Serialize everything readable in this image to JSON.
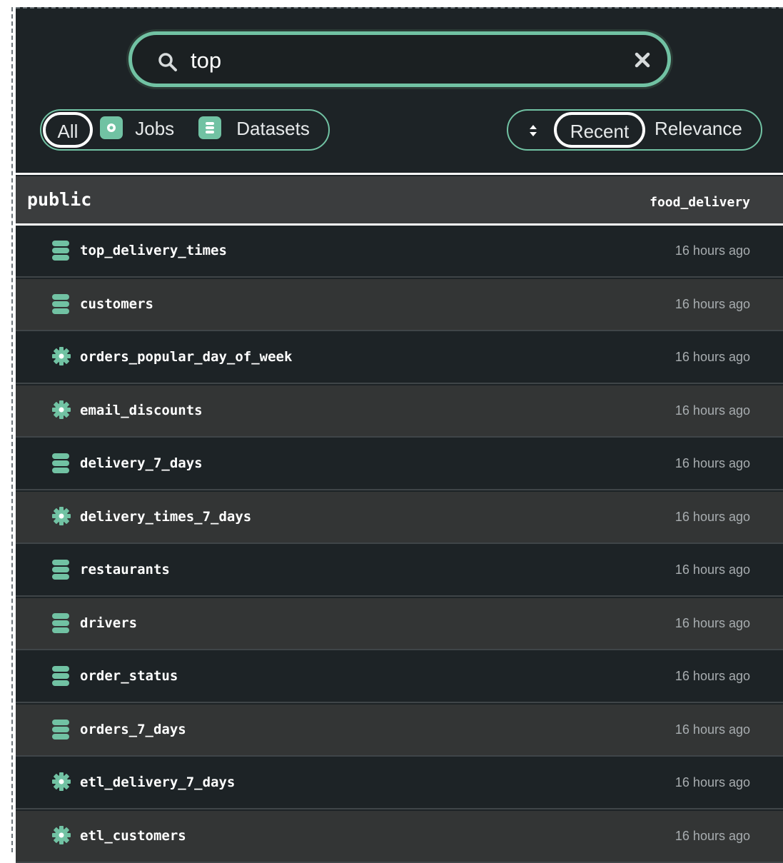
{
  "search": {
    "value": "top",
    "clear_icon": "close-icon",
    "icon": "search-icon"
  },
  "filters": [
    {
      "label": "All",
      "icon": "",
      "active": true
    },
    {
      "label": "Jobs",
      "icon": "job-icon",
      "active": false
    },
    {
      "label": "Datasets",
      "icon": "dataset-icon",
      "active": false
    }
  ],
  "sort": {
    "icon": "sort-icon",
    "options": [
      {
        "label": "Recent",
        "active": true
      },
      {
        "label": "Relevance",
        "active": false
      }
    ]
  },
  "group": {
    "title": "public",
    "namespace": "food_delivery"
  },
  "results": [
    {
      "type": "dataset",
      "name": "top_delivery_times",
      "time": "16 hours ago"
    },
    {
      "type": "dataset",
      "name": "customers",
      "time": "16 hours ago"
    },
    {
      "type": "job",
      "name": "orders_popular_day_of_week",
      "time": "16 hours ago"
    },
    {
      "type": "job",
      "name": "email_discounts",
      "time": "16 hours ago"
    },
    {
      "type": "dataset",
      "name": "delivery_7_days",
      "time": "16 hours ago"
    },
    {
      "type": "job",
      "name": "delivery_times_7_days",
      "time": "16 hours ago"
    },
    {
      "type": "dataset",
      "name": "restaurants",
      "time": "16 hours ago"
    },
    {
      "type": "dataset",
      "name": "drivers",
      "time": "16 hours ago"
    },
    {
      "type": "dataset",
      "name": "order_status",
      "time": "16 hours ago"
    },
    {
      "type": "dataset",
      "name": "orders_7_days",
      "time": "16 hours ago"
    },
    {
      "type": "job",
      "name": "etl_delivery_7_days",
      "time": "16 hours ago"
    },
    {
      "type": "job",
      "name": "etl_customers",
      "time": "16 hours ago"
    }
  ],
  "colors": {
    "accent": "#71c2a3",
    "panel": "#1d2326",
    "row_alt": "#333535",
    "header": "#3b3d3e"
  }
}
